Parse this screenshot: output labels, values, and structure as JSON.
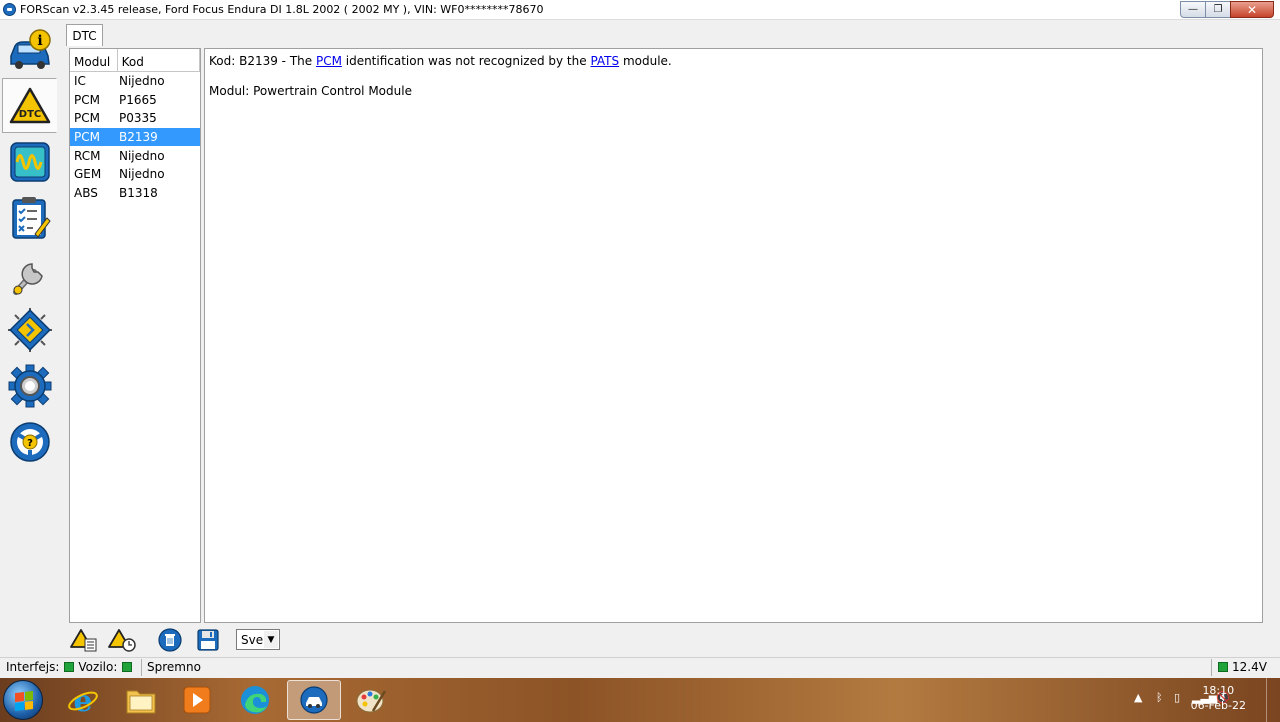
{
  "window": {
    "title": "FORScan v2.3.45 release, Ford Focus Endura DI 1.8L 2002 ( 2002 MY ), VIN: WF0********78670",
    "minimize": "—",
    "maximize": "❐",
    "close": "✕"
  },
  "tab": {
    "label": "DTC"
  },
  "dtc_list": {
    "headers": {
      "module": "Modul",
      "code": "Kod"
    },
    "rows": [
      {
        "module": "IC",
        "code": "Nijedno"
      },
      {
        "module": "PCM",
        "code": "P1665"
      },
      {
        "module": "PCM",
        "code": "P0335"
      },
      {
        "module": "PCM",
        "code": "B2139"
      },
      {
        "module": "RCM",
        "code": "Nijedno"
      },
      {
        "module": "GEM",
        "code": "Nijedno"
      },
      {
        "module": "ABS",
        "code": "B1318"
      }
    ],
    "selected_index": 3
  },
  "detail": {
    "prefix": "Kod: B2139 - The ",
    "link1": "PCM",
    "middle": " identification was not recognized by the ",
    "link2": "PATS",
    "suffix": " module.",
    "module_line": "Modul: Powertrain Control Module"
  },
  "toolbar": {
    "filter_value": "Sve",
    "filter_arrow": "▼"
  },
  "status": {
    "interface_label": "Interfejs:",
    "vehicle_label": "Vozilo:",
    "state_text": "Spremno",
    "voltage": "12.4V",
    "led_color": "#1fa33a"
  },
  "taskbar": {
    "time": "18:10",
    "date": "06-Feb-22"
  },
  "colors": {
    "selection": "#3399ff",
    "link": "#0000ee",
    "accent_blue": "#1d6bbd",
    "warning_yellow": "#f5c400"
  }
}
